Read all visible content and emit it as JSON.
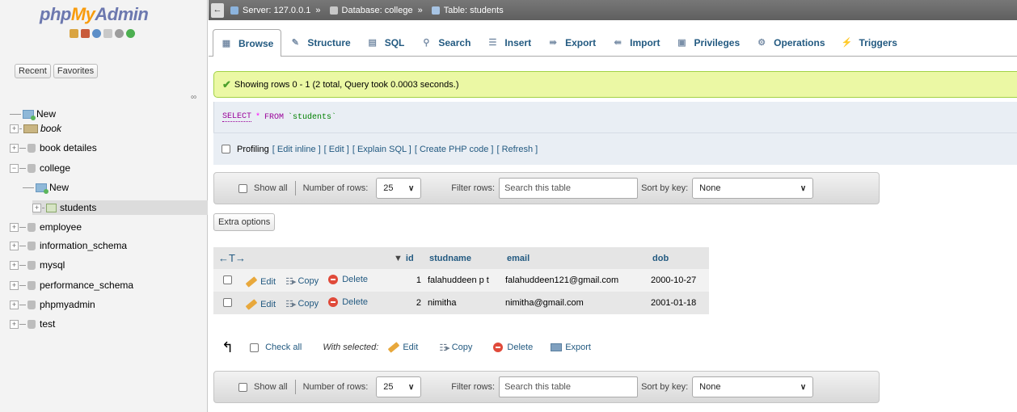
{
  "nav": {
    "logo_php": "php",
    "logo_my": "My",
    "logo_admin": "Admin",
    "recent": "Recent",
    "favorites": "Favorites",
    "tree": [
      {
        "label": "New",
        "kind": "new"
      },
      {
        "label": "book",
        "kind": "book"
      },
      {
        "label": "book detailes",
        "kind": "db"
      },
      {
        "label": "college",
        "kind": "db"
      },
      {
        "label": "New",
        "kind": "new"
      },
      {
        "label": "students",
        "kind": "table"
      },
      {
        "label": "employee",
        "kind": "db"
      },
      {
        "label": "information_schema",
        "kind": "db"
      },
      {
        "label": "mysql",
        "kind": "db"
      },
      {
        "label": "performance_schema",
        "kind": "db"
      },
      {
        "label": "phpmyadmin",
        "kind": "db"
      },
      {
        "label": "test",
        "kind": "db"
      }
    ]
  },
  "breadcrumb": {
    "collapse": "←",
    "server": "Server: 127.0.0.1",
    "database": "Database: college",
    "table": "Table: students",
    "sep": "»"
  },
  "tabs": [
    {
      "label": "Browse",
      "icon": "▦",
      "active": true
    },
    {
      "label": "Structure",
      "icon": "✎"
    },
    {
      "label": "SQL",
      "icon": "▤"
    },
    {
      "label": "Search",
      "icon": "⚲"
    },
    {
      "label": "Insert",
      "icon": "☰"
    },
    {
      "label": "Export",
      "icon": "⇛"
    },
    {
      "label": "Import",
      "icon": "⇚"
    },
    {
      "label": "Privileges",
      "icon": "▣"
    },
    {
      "label": "Operations",
      "icon": "⚙"
    },
    {
      "label": "Triggers",
      "icon": "⚡"
    }
  ],
  "message": "Showing rows 0 - 1 (2 total, Query took 0.0003 seconds.)",
  "sql": {
    "select": "SELECT",
    "star": "*",
    "from": "FROM",
    "table": "`students`"
  },
  "profiling": {
    "label": "Profiling",
    "links": [
      "[ Edit inline ]",
      "[ Edit ]",
      "[ Explain SQL ]",
      "[ Create PHP code ]",
      "[ Refresh ]"
    ]
  },
  "navbar": {
    "show_all": "Show all",
    "num_rows_label": "Number of rows:",
    "num_rows_value": "25",
    "filter_label": "Filter rows:",
    "filter_placeholder": "Search this table",
    "sort_label": "Sort by key:",
    "sort_value": "None"
  },
  "extra_options": "Extra options",
  "table": {
    "arrows": "←T→",
    "sort_indicator": "▼",
    "columns": [
      "id",
      "studname",
      "email",
      "dob"
    ],
    "actions": {
      "edit": "Edit",
      "copy": "Copy",
      "delete": "Delete"
    },
    "rows": [
      {
        "id": "1",
        "studname": "falahuddeen p t",
        "email": "falahuddeen121@gmail.com",
        "dob": "2000-10-27"
      },
      {
        "id": "2",
        "studname": "nimitha",
        "email": "nimitha@gmail.com",
        "dob": "2001-01-18"
      }
    ]
  },
  "bulk": {
    "check_all": "Check all",
    "with_selected": "With selected:",
    "edit": "Edit",
    "copy": "Copy",
    "delete": "Delete",
    "export": "Export"
  },
  "colors": {
    "logo_blue": "#6c78af",
    "logo_orange": "#f89c0e",
    "link": "#235a81",
    "success_bg": "#ebf8a4"
  }
}
